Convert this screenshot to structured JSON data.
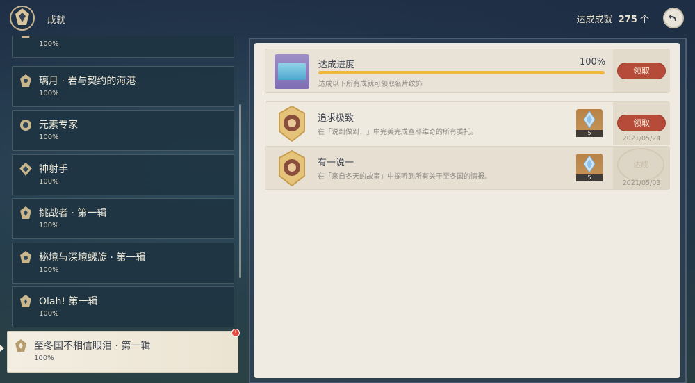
{
  "header": {
    "title": "成就",
    "total_label": "达成成就",
    "total_count": "275",
    "total_unit": "个"
  },
  "sidebar": {
    "items": [
      {
        "name": "",
        "percent": "100%"
      },
      {
        "name": "璃月 · 岩与契约的海港",
        "percent": "100%"
      },
      {
        "name": "元素专家",
        "percent": "100%"
      },
      {
        "name": "神射手",
        "percent": "100%"
      },
      {
        "name": "挑战者 · 第一辑",
        "percent": "100%"
      },
      {
        "name": "秘境与深境螺旋 · 第一辑",
        "percent": "100%"
      },
      {
        "name": "Olah! 第一辑",
        "percent": "100%"
      },
      {
        "name": "至冬国不相信眼泪 · 第一辑",
        "percent": "100%",
        "selected": true,
        "alert": "!"
      }
    ]
  },
  "progress": {
    "title": "达成进度",
    "percent_text": "100%",
    "percent_value": 100,
    "description": "达成以下所有成就可领取名片纹饰",
    "claim_label": "领取"
  },
  "achievements": [
    {
      "name": "追求极致",
      "description": "在「说到做到！」中完美完成查耶维奇的所有委托。",
      "reward_count": "5",
      "claim_label": "领取",
      "date": "2021/05/24",
      "status": "claimable"
    },
    {
      "name": "有一说一",
      "description": "在「来自冬天的故事」中探听到所有关于至冬国的情报。",
      "reward_count": "5",
      "stamp_label": "达成",
      "date": "2021/05/03",
      "status": "claimed"
    }
  ],
  "colors": {
    "accent_gold": "#f0b93e",
    "claim_red": "#b74b3a",
    "panel_bg": "#f0ebe2"
  }
}
